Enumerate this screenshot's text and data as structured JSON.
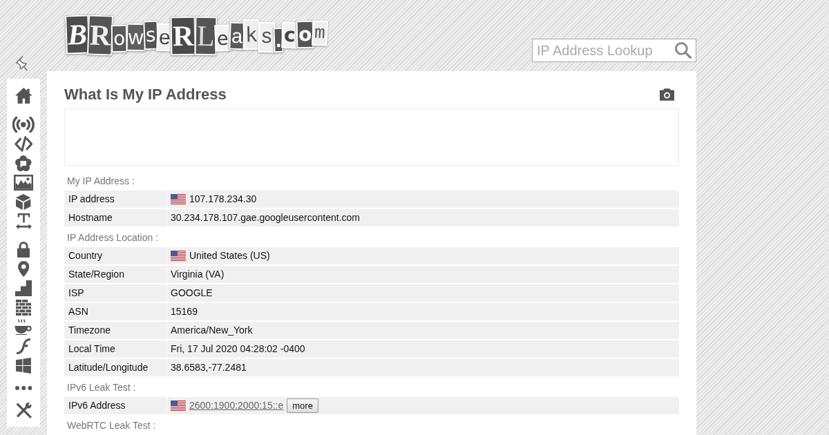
{
  "logo": {
    "text": "BRowseRLeaks.com"
  },
  "search": {
    "placeholder": "IP Address Lookup"
  },
  "page": {
    "title": "What Is My IP Address"
  },
  "sections": [
    {
      "heading": "My IP Address :",
      "rows": [
        {
          "kind": "flag",
          "label": "IP address",
          "value": "107.178.234.30"
        },
        {
          "kind": "text",
          "label": "Hostname",
          "value": "30.234.178.107.gae.googleusercontent.com"
        }
      ]
    },
    {
      "heading": "IP Address Location :",
      "rows": [
        {
          "kind": "flag",
          "label": "Country",
          "value": "United States (US)"
        },
        {
          "kind": "text",
          "label": "State/Region",
          "value": "Virginia (VA)"
        },
        {
          "kind": "text",
          "label": "ISP",
          "value": "GOOGLE"
        },
        {
          "kind": "text",
          "label": "ASN",
          "value": "15169"
        },
        {
          "kind": "text",
          "label": "Timezone",
          "value": "America/New_York"
        },
        {
          "kind": "text",
          "label": "Local Time",
          "value": "Fri, 17 Jul 2020 04:28:02 -0400"
        },
        {
          "kind": "text",
          "label": "Latitude/Longitude",
          "value": "38.6583,-77.2481"
        }
      ]
    },
    {
      "heading": "IPv6 Leak Test :",
      "rows": [
        {
          "kind": "flag_link",
          "label": "IPv6 Address",
          "value": "2600:1900:2000:15::e",
          "button": "more"
        }
      ]
    },
    {
      "heading": "WebRTC Leak Test :"
    }
  ]
}
